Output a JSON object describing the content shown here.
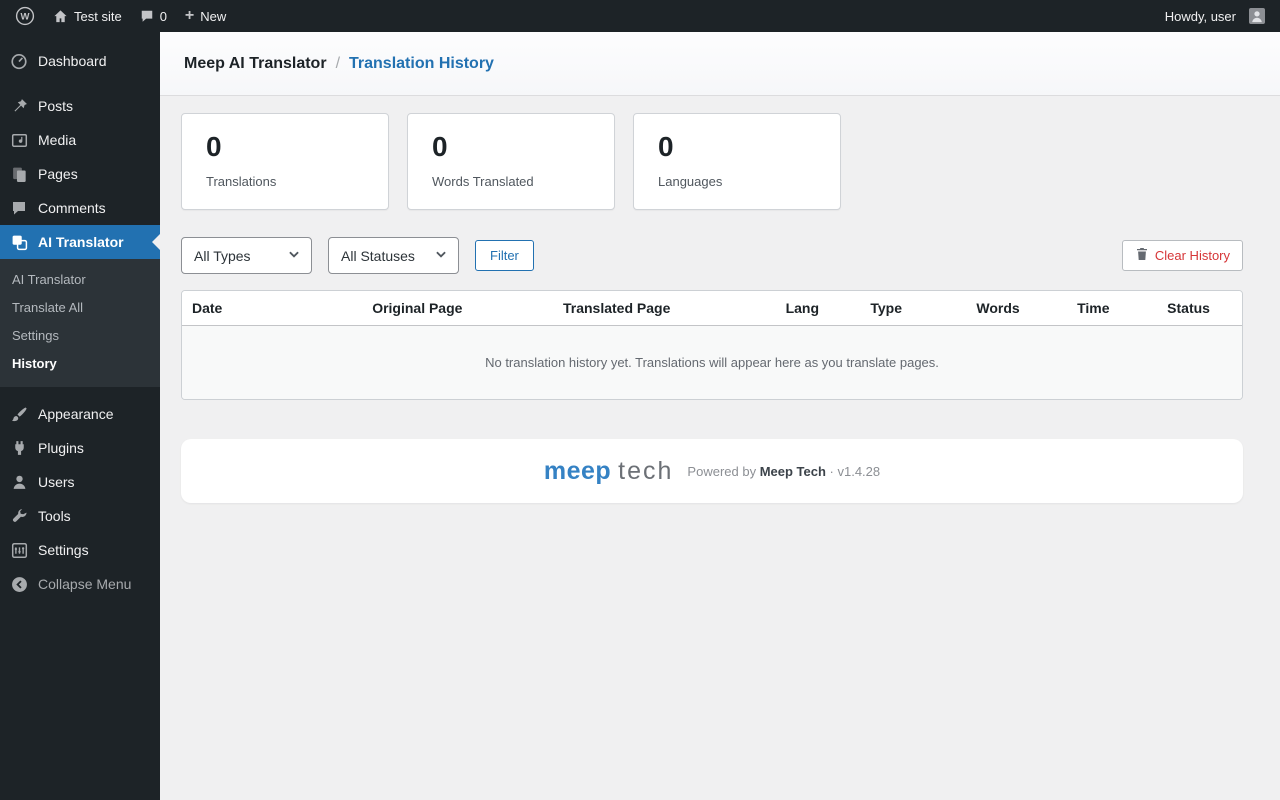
{
  "admin_bar": {
    "site_name": "Test site",
    "comments_count": "0",
    "new_label": "New",
    "howdy": "Howdy, user"
  },
  "sidebar": {
    "items": [
      {
        "label": "Dashboard"
      },
      {
        "label": "Posts"
      },
      {
        "label": "Media"
      },
      {
        "label": "Pages"
      },
      {
        "label": "Comments"
      },
      {
        "label": "AI Translator"
      },
      {
        "label": "Appearance"
      },
      {
        "label": "Plugins"
      },
      {
        "label": "Users"
      },
      {
        "label": "Tools"
      },
      {
        "label": "Settings"
      },
      {
        "label": "Collapse Menu"
      }
    ],
    "submenu": [
      "AI Translator",
      "Translate All",
      "Settings",
      "History"
    ]
  },
  "header": {
    "title": "Meep AI Translator",
    "separator": "/",
    "breadcrumb_current": "Translation History"
  },
  "stats": [
    {
      "value": "0",
      "label": "Translations"
    },
    {
      "value": "0",
      "label": "Words Translated"
    },
    {
      "value": "0",
      "label": "Languages"
    }
  ],
  "filters": {
    "type_select": "All Types",
    "status_select": "All Statuses",
    "filter_button": "Filter",
    "clear_history_button": "Clear History"
  },
  "table": {
    "headers": [
      "Date",
      "Original Page",
      "Translated Page",
      "Lang",
      "Type",
      "Words",
      "Time",
      "Status"
    ],
    "empty_message": "No translation history yet. Translations will appear here as you translate pages."
  },
  "footer": {
    "logo_meep": "meep",
    "logo_tech": "tech",
    "powered_by": "Powered by",
    "brand": "Meep Tech",
    "version": "· v1.4.28"
  },
  "colors": {
    "accent_blue": "#2271b1",
    "danger_red": "#d63638",
    "sidebar_dark": "#1d2327"
  }
}
